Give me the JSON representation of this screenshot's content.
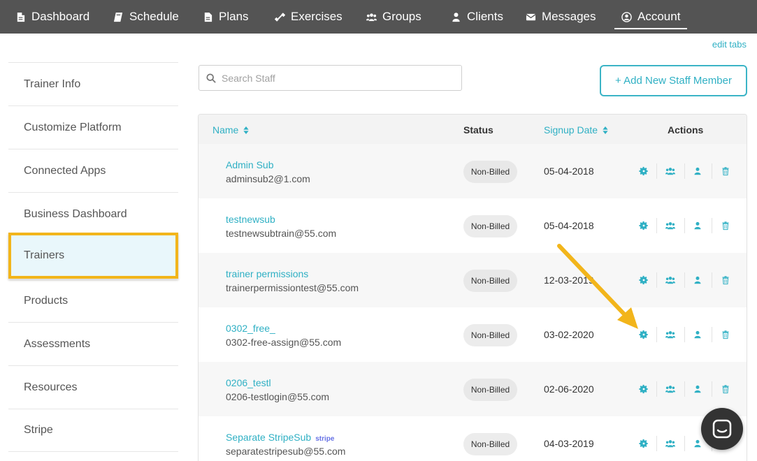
{
  "nav": {
    "tabs": [
      {
        "label": "Dashboard",
        "icon": "document-icon"
      },
      {
        "label": "Schedule",
        "icon": "book-icon"
      },
      {
        "label": "Plans",
        "icon": "document-icon"
      },
      {
        "label": "Exercises",
        "icon": "dumbbell-icon"
      },
      {
        "label": "Groups",
        "icon": "group-icon"
      },
      {
        "label": "Clients",
        "icon": "person-icon"
      },
      {
        "label": "Messages",
        "icon": "envelope-icon"
      },
      {
        "label": "Account",
        "icon": "user-circle-icon",
        "active": true
      }
    ]
  },
  "edit_tabs": "edit tabs",
  "sidebar": {
    "items": [
      {
        "label": "Trainer Info"
      },
      {
        "label": "Customize Platform"
      },
      {
        "label": "Connected Apps"
      },
      {
        "label": "Business Dashboard"
      },
      {
        "label": "Trainers",
        "active": true
      },
      {
        "label": "Products"
      },
      {
        "label": "Assessments"
      },
      {
        "label": "Resources"
      },
      {
        "label": "Stripe"
      }
    ]
  },
  "search": {
    "placeholder": "Search Staff"
  },
  "add_button": {
    "label": "+ Add New Staff Member"
  },
  "table": {
    "headers": {
      "name": "Name",
      "status": "Status",
      "signup": "Signup Date",
      "actions": "Actions"
    },
    "rows": [
      {
        "name": "Admin Sub",
        "email": "adminsub2@1.com",
        "status": "Non-Billed",
        "date": "05-04-2018",
        "tag": ""
      },
      {
        "name": "testnewsub",
        "email": "testnewsubtrain@55.com",
        "status": "Non-Billed",
        "date": "05-04-2018",
        "tag": ""
      },
      {
        "name": "trainer permissions",
        "email": "trainerpermissiontest@55.com",
        "status": "Non-Billed",
        "date": "12-03-2019",
        "tag": ""
      },
      {
        "name": "0302_free_",
        "email": "0302-free-assign@55.com",
        "status": "Non-Billed",
        "date": "03-02-2020",
        "tag": ""
      },
      {
        "name": "0206_testl",
        "email": "0206-testlogin@55.com",
        "status": "Non-Billed",
        "date": "02-06-2020",
        "tag": ""
      },
      {
        "name": "Separate StripeSub",
        "email": "separatestripesub@55.com",
        "status": "Non-Billed",
        "date": "04-03-2019",
        "tag": "stripe"
      }
    ]
  },
  "colors": {
    "accent": "#2fb0c4",
    "nav_bg": "#545454",
    "highlight": "#f2b51b",
    "stripe": "#6772e5"
  }
}
